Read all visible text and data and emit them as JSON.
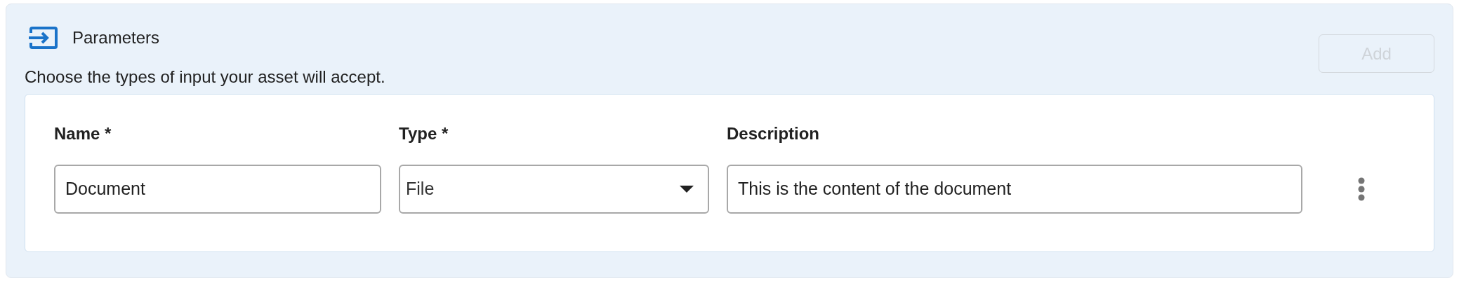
{
  "section": {
    "title": "Parameters",
    "description": "Choose the types of input your asset will accept."
  },
  "add_button": {
    "label": "Add",
    "disabled": true
  },
  "table": {
    "columns": [
      "Name *",
      "Type *",
      "Description"
    ],
    "rows": [
      {
        "name": "Document",
        "type": "File",
        "description": "This is the content of the document"
      }
    ]
  }
}
